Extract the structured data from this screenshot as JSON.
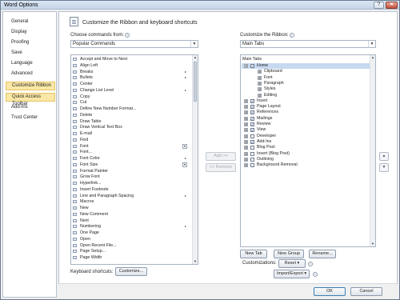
{
  "window": {
    "title": "Word Options",
    "help_glyph": "?",
    "close_glyph": "✕"
  },
  "nav": {
    "items": [
      {
        "label": "General",
        "highlighted": false
      },
      {
        "label": "Display",
        "highlighted": false
      },
      {
        "label": "Proofing",
        "highlighted": false
      },
      {
        "label": "Save",
        "highlighted": false
      },
      {
        "label": "Language",
        "highlighted": false
      },
      {
        "label": "Advanced",
        "highlighted": false
      },
      {
        "label": "Customize Ribbon",
        "highlighted": true
      },
      {
        "label": "Quick Access Toolbar",
        "highlighted": true
      },
      {
        "label": "Add-Ins",
        "highlighted": false
      },
      {
        "label": "Trust Center",
        "highlighted": false
      }
    ]
  },
  "main": {
    "heading": "Customize the Ribbon and keyboard shortcuts",
    "choose_label": "Choose commands from:",
    "choose_value": "Popular Commands",
    "customize_label": "Customize the Ribbon:",
    "customize_value": "Main Tabs",
    "info_glyph": "i",
    "commands": [
      {
        "label": "Accept and Move to Next",
        "marker": ""
      },
      {
        "label": "Align Left",
        "marker": ""
      },
      {
        "label": "Breaks",
        "marker": "▸"
      },
      {
        "label": "Bullets",
        "marker": "▸"
      },
      {
        "label": "Center",
        "marker": ""
      },
      {
        "label": "Change List Level",
        "marker": "▸"
      },
      {
        "label": "Copy",
        "marker": ""
      },
      {
        "label": "Cut",
        "marker": ""
      },
      {
        "label": "Define New Number Format...",
        "marker": ""
      },
      {
        "label": "Delete",
        "marker": ""
      },
      {
        "label": "Draw Table",
        "marker": ""
      },
      {
        "label": "Draw Vertical Text Box",
        "marker": ""
      },
      {
        "label": "E-mail",
        "marker": ""
      },
      {
        "label": "Find",
        "marker": ""
      },
      {
        "label": "Font",
        "marker": "box"
      },
      {
        "label": "Font...",
        "marker": ""
      },
      {
        "label": "Font Color",
        "marker": "▸"
      },
      {
        "label": "Font Size",
        "marker": "box"
      },
      {
        "label": "Format Painter",
        "marker": ""
      },
      {
        "label": "Grow Font",
        "marker": ""
      },
      {
        "label": "Hyperlink...",
        "marker": ""
      },
      {
        "label": "Insert Footnote",
        "marker": ""
      },
      {
        "label": "Line and Paragraph Spacing",
        "marker": "▸"
      },
      {
        "label": "Macros",
        "marker": ""
      },
      {
        "label": "New",
        "marker": ""
      },
      {
        "label": "New Comment",
        "marker": ""
      },
      {
        "label": "Next",
        "marker": ""
      },
      {
        "label": "Numbering",
        "marker": "▸"
      },
      {
        "label": "One Page",
        "marker": ""
      },
      {
        "label": "Open",
        "marker": ""
      },
      {
        "label": "Open Recent File...",
        "marker": ""
      },
      {
        "label": "Page Setup...",
        "marker": ""
      },
      {
        "label": "Page Width",
        "marker": ""
      }
    ],
    "tree_header": "Main Tabs",
    "tree": [
      {
        "label": "Home",
        "level": 0,
        "expander": "⊟",
        "checked": true,
        "selected": true
      },
      {
        "label": "Clipboard",
        "level": 1,
        "expander": "⊞",
        "checked": null,
        "selected": false
      },
      {
        "label": "Font",
        "level": 1,
        "expander": "⊞",
        "checked": null,
        "selected": false
      },
      {
        "label": "Paragraph",
        "level": 1,
        "expander": "⊞",
        "checked": null,
        "selected": false
      },
      {
        "label": "Styles",
        "level": 1,
        "expander": "⊞",
        "checked": null,
        "selected": false
      },
      {
        "label": "Editing",
        "level": 1,
        "expander": "⊞",
        "checked": null,
        "selected": false
      },
      {
        "label": "Insert",
        "level": 0,
        "expander": "⊞",
        "checked": true,
        "selected": false
      },
      {
        "label": "Page Layout",
        "level": 0,
        "expander": "⊞",
        "checked": true,
        "selected": false
      },
      {
        "label": "References",
        "level": 0,
        "expander": "⊞",
        "checked": true,
        "selected": false
      },
      {
        "label": "Mailings",
        "level": 0,
        "expander": "⊞",
        "checked": true,
        "selected": false
      },
      {
        "label": "Review",
        "level": 0,
        "expander": "⊞",
        "checked": true,
        "selected": false
      },
      {
        "label": "View",
        "level": 0,
        "expander": "⊞",
        "checked": true,
        "selected": false
      },
      {
        "label": "Developer",
        "level": 0,
        "expander": "⊞",
        "checked": false,
        "selected": false
      },
      {
        "label": "Add-Ins",
        "level": 0,
        "expander": "⊞",
        "checked": true,
        "selected": false
      },
      {
        "label": "Blog Post",
        "level": 0,
        "expander": "⊞",
        "checked": false,
        "selected": false
      },
      {
        "label": "Insert (Blog Post)",
        "level": 0,
        "expander": "⊞",
        "checked": false,
        "selected": false
      },
      {
        "label": "Outlining",
        "level": 0,
        "expander": "⊞",
        "checked": false,
        "selected": false
      },
      {
        "label": "Background Removal",
        "level": 0,
        "expander": "⊞",
        "checked": false,
        "selected": false
      }
    ],
    "add_label": "Add >>",
    "remove_label": "<< Remove",
    "up_glyph": "▲",
    "down_glyph": "▼",
    "new_tab_label": "New Tab",
    "new_group_label": "New Group",
    "rename_label": "Rename...",
    "customizations_label": "Customizations:",
    "reset_label": "Reset ▾",
    "import_export_label": "Import/Export ▾",
    "keyboard_label": "Keyboard shortcuts:",
    "customize_btn_label": "Customize..."
  },
  "footer": {
    "ok_label": "OK",
    "cancel_label": "Cancel"
  }
}
